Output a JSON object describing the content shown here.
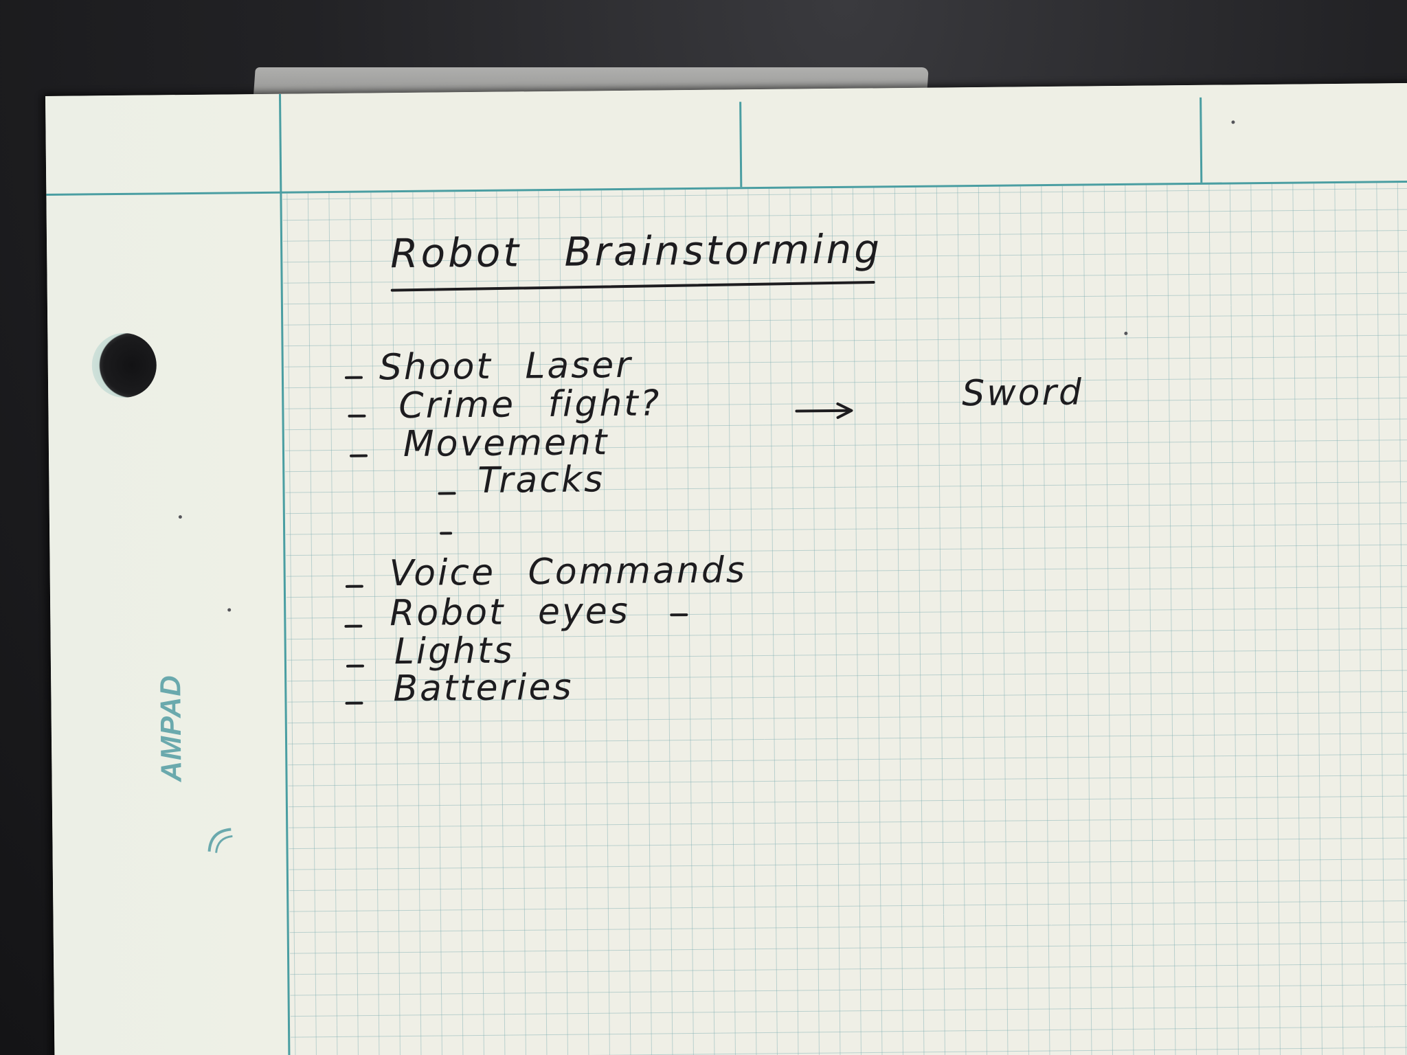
{
  "brand": "AMPAD",
  "title": "Robot Brainstorming",
  "items": [
    {
      "text": "Shoot Laser"
    },
    {
      "text": "Crime fight?"
    },
    {
      "text": "Movement"
    },
    {
      "text": "Tracks"
    },
    {
      "text": ""
    },
    {
      "text": "Voice Commands"
    },
    {
      "text": "Robot eyes"
    },
    {
      "text": "Lights"
    },
    {
      "text": "Batteries"
    }
  ],
  "arrow_target": "Sword",
  "colors": {
    "ink": "#1d1c1f",
    "grid": "#78aaaf",
    "rule": "#4a9ea2",
    "paper": "#eeeee4",
    "desk": "#1b1b1d"
  }
}
